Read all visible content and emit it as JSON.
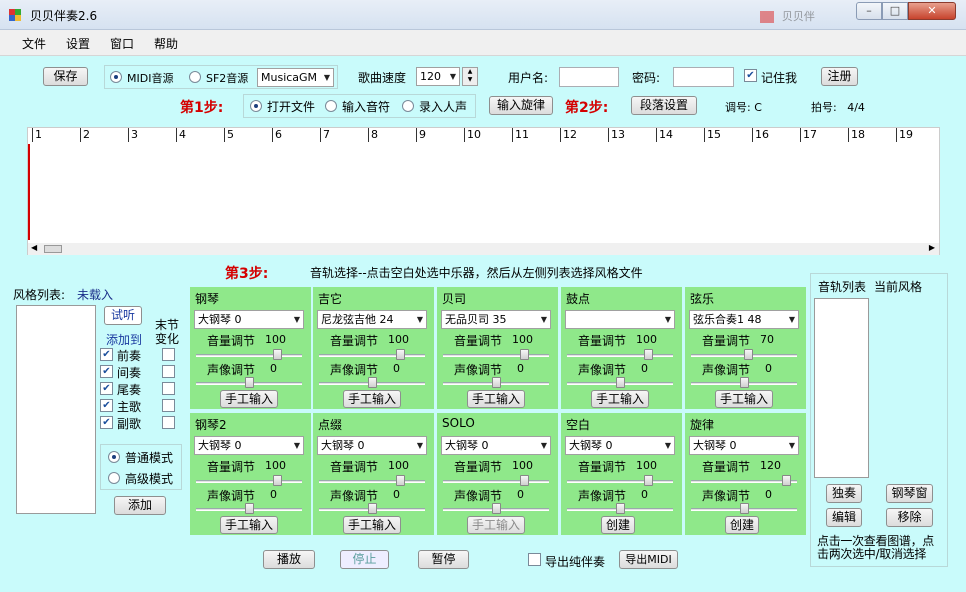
{
  "window": {
    "title": "贝贝伴奏2.6",
    "bg_app_title": "贝贝伴"
  },
  "menu": [
    "文件",
    "设置",
    "窗口",
    "帮助"
  ],
  "toolbar": {
    "save": "保存",
    "midi_source": "MIDI音源",
    "sf2_source": "SF2音源",
    "sound_select": "MusicaGM",
    "speed_label": "歌曲速度",
    "speed_value": "120",
    "username_label": "用户名:",
    "password_label": "密码:",
    "remember": "记住我",
    "register": "注册"
  },
  "step1": {
    "label": "第1步:",
    "open_file": "打开文件",
    "input_note": "输入音符",
    "record_voice": "录入人声",
    "input_melody": "输入旋律"
  },
  "step2": {
    "label": "第2步:",
    "section_settings": "段落设置",
    "key_label": "调号:",
    "key_value": "C",
    "meter_label": "拍号:",
    "meter_value": "4/4"
  },
  "ruler": [
    "1",
    "2",
    "3",
    "4",
    "5",
    "6",
    "7",
    "8",
    "9",
    "10",
    "11",
    "12",
    "13",
    "14",
    "15",
    "16",
    "17",
    "18",
    "19"
  ],
  "step3": {
    "label": "第3步:",
    "instruction": "音轨选择--点击空白处选中乐器，然后从左侧列表选择风格文件"
  },
  "style_list": {
    "label": "风格列表:",
    "status": "未载入",
    "listen": "试听",
    "add_to": "添加到",
    "section_change": "末节变化",
    "sections": [
      "前奏",
      "间奏",
      "尾奏",
      "主歌",
      "副歌"
    ],
    "normal_mode": "普通模式",
    "advanced_mode": "高级模式",
    "add": "添加"
  },
  "labels": {
    "volume": "音量调节",
    "pan": "声像调节",
    "manual": "手工输入",
    "create": "创建"
  },
  "tracks": [
    {
      "title": "钢琴",
      "instrument": "大钢琴 0",
      "volume": "100",
      "pan": "0",
      "vol_level": 0.79,
      "pan_level": 0.5,
      "action": "手工输入"
    },
    {
      "title": "吉它",
      "instrument": "尼龙弦吉他 24",
      "volume": "100",
      "pan": "0",
      "vol_level": 0.79,
      "pan_level": 0.5,
      "action": "手工输入"
    },
    {
      "title": "贝司",
      "instrument": "无品贝司 35",
      "volume": "100",
      "pan": "0",
      "vol_level": 0.79,
      "pan_level": 0.5,
      "action": "手工输入"
    },
    {
      "title": "鼓点",
      "instrument": "",
      "volume": "100",
      "pan": "0",
      "vol_level": 0.79,
      "pan_level": 0.5,
      "action": "手工输入"
    },
    {
      "title": "弦乐",
      "instrument": "弦乐合奏1 48",
      "volume": "70",
      "pan": "0",
      "vol_level": 0.55,
      "pan_level": 0.5,
      "action": "手工输入"
    },
    {
      "title": "钢琴2",
      "instrument": "大钢琴 0",
      "volume": "100",
      "pan": "0",
      "vol_level": 0.79,
      "pan_level": 0.5,
      "action": "手工输入"
    },
    {
      "title": "点缀",
      "instrument": "大钢琴 0",
      "volume": "100",
      "pan": "0",
      "vol_level": 0.79,
      "pan_level": 0.5,
      "action": "手工输入"
    },
    {
      "title": "SOLO",
      "instrument": "大钢琴 0",
      "volume": "100",
      "pan": "0",
      "vol_level": 0.79,
      "pan_level": 0.5,
      "action": "手工输入",
      "action_disabled": true
    },
    {
      "title": "空白",
      "instrument": "大钢琴 0",
      "volume": "100",
      "pan": "0",
      "vol_level": 0.79,
      "pan_level": 0.5,
      "action": "创建"
    },
    {
      "title": "旋律",
      "instrument": "大钢琴 0",
      "volume": "120",
      "pan": "0",
      "vol_level": 0.94,
      "pan_level": 0.5,
      "action": "创建"
    }
  ],
  "right": {
    "track_list": "音轨列表",
    "current_style": "当前风格",
    "solo": "独奏",
    "piano_window": "钢琴窗",
    "edit": "编辑",
    "remove": "移除",
    "hint": "点击一次查看图谱，点击两次选中/取消选择"
  },
  "bottom": {
    "play": "播放",
    "stop": "停止",
    "pause": "暂停",
    "export_pure": "导出纯伴奏",
    "export_midi": "导出MIDI"
  }
}
